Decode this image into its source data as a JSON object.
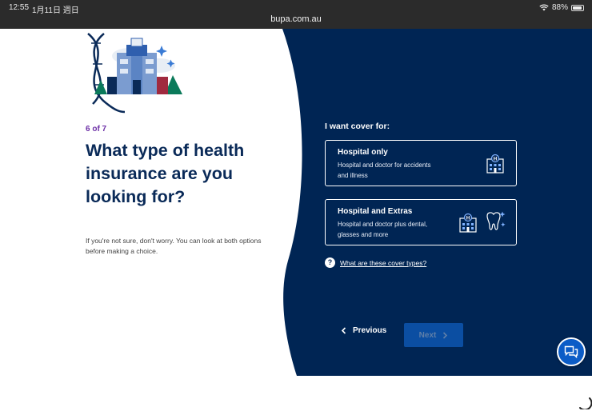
{
  "status_bar": {
    "time": "12:55",
    "date": "1月11日 週日",
    "url": "bupa.com.au",
    "battery": "88%"
  },
  "quiz": {
    "step": "6 of 7",
    "question": "What type of health insurance are you looking for?",
    "helper": "If you're not sure, don't worry. You can look at both options before making a choice."
  },
  "cover": {
    "label": "I want cover for:",
    "options": [
      {
        "title": "Hospital only",
        "desc": "Hospital and doctor for accidents and illness",
        "icon": "hospital-icon"
      },
      {
        "title": "Hospital and Extras",
        "desc": "Hospital and doctor plus dental, glasses and more",
        "icon": "hospital-tooth-icon"
      }
    ],
    "help_link": "What are these cover types?"
  },
  "nav": {
    "previous": "Previous",
    "next": "Next"
  },
  "colors": {
    "navy": "#0a2a58",
    "step_purple": "#6c2fa6",
    "next_button": "#0b4ea2",
    "chat_button": "#0b5cc7"
  }
}
